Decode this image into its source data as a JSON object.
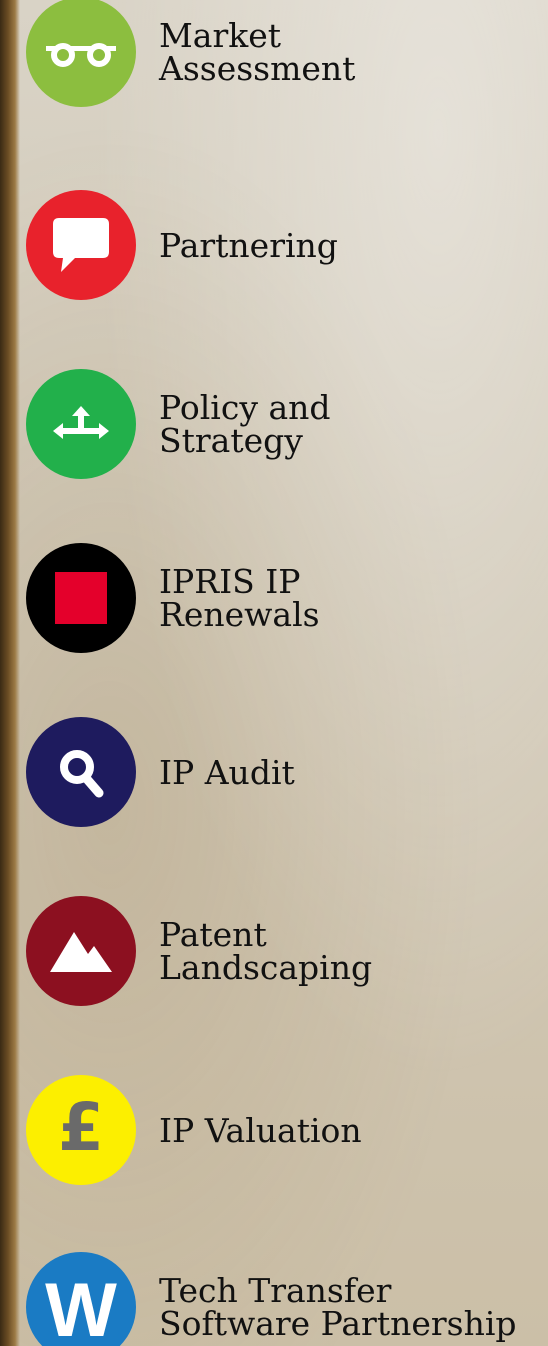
{
  "services": [
    {
      "label": "Market\nAssessment",
      "icon": "glasses-icon",
      "color": "#8cbe3f"
    },
    {
      "label": "Partnering",
      "icon": "speech-bubble-icon",
      "color": "#e8222c"
    },
    {
      "label": "Policy and\nStrategy",
      "icon": "direction-arrows-icon",
      "color": "#22b04b"
    },
    {
      "label": "IPRIS IP\nRenewals",
      "icon": "red-square-icon",
      "color": "#000000"
    },
    {
      "label": "IP Audit",
      "icon": "magnifier-icon",
      "color": "#1e1b5e"
    },
    {
      "label": "Patent\nLandscaping",
      "icon": "mountains-icon",
      "color": "#8c1020"
    },
    {
      "label": "IP Valuation",
      "icon": "pound-icon",
      "color": "#fcef00",
      "glyph": "£"
    },
    {
      "label": "Tech Transfer\nSoftware Partnership",
      "icon": "w-letter-icon",
      "color": "#1a7bc4",
      "glyph": "W"
    }
  ]
}
